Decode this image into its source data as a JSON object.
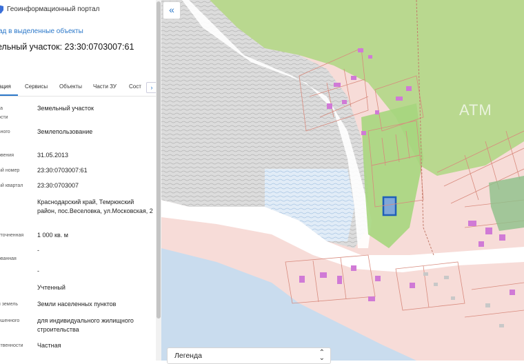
{
  "app": {
    "title": "Геоинформационный портал",
    "back_link": "ад в выделенные объекты"
  },
  "parcel": {
    "title": "ельный участок: 23:30:0703007:61"
  },
  "tabs": [
    {
      "label": "ация"
    },
    {
      "label": "Сервисы"
    },
    {
      "label": "Объекты"
    },
    {
      "label": "Части ЗУ"
    },
    {
      "label": "Сост"
    }
  ],
  "fields": [
    {
      "key": "та",
      "key2": "ости",
      "value": "Земельный участок"
    },
    {
      "key": "ьного",
      "value": "Землепользование"
    },
    {
      "key": "овения",
      "value": "31.05.2013"
    },
    {
      "key": "ый номер",
      "value": "23:30:0703007:61"
    },
    {
      "key": "ый квартал",
      "value": "23:30:0703007"
    },
    {
      "key": "",
      "value": "Краснодарский край, Темрюкский район, пос.Веселовка, ул.Московская, 2"
    },
    {
      "key": "уточненная",
      "value": "1 000 кв. м"
    },
    {
      "key": "ованная",
      "value": "-"
    },
    {
      "key": "",
      "value": "-"
    },
    {
      "key": "",
      "value": "Учтенный"
    },
    {
      "key": "я земель",
      "value": "Земли населенных пунктов"
    },
    {
      "key": "ешенного",
      "value": "для индивидуального жилищного строительства"
    },
    {
      "key": "ственности",
      "value": "Частная"
    }
  ],
  "map": {
    "legend_label": "Легенда",
    "watermark": "АТМ"
  },
  "icons": {
    "collapse": "double-chevron-left-icon",
    "legend_toggle": "chevron-up-down-icon",
    "brand": "shield-icon"
  },
  "colors": {
    "accent": "#2a77c9",
    "water": "#c9dcee",
    "residential": "#f7d9d6",
    "green": "#b7d68f",
    "building": "#d07ad6"
  }
}
